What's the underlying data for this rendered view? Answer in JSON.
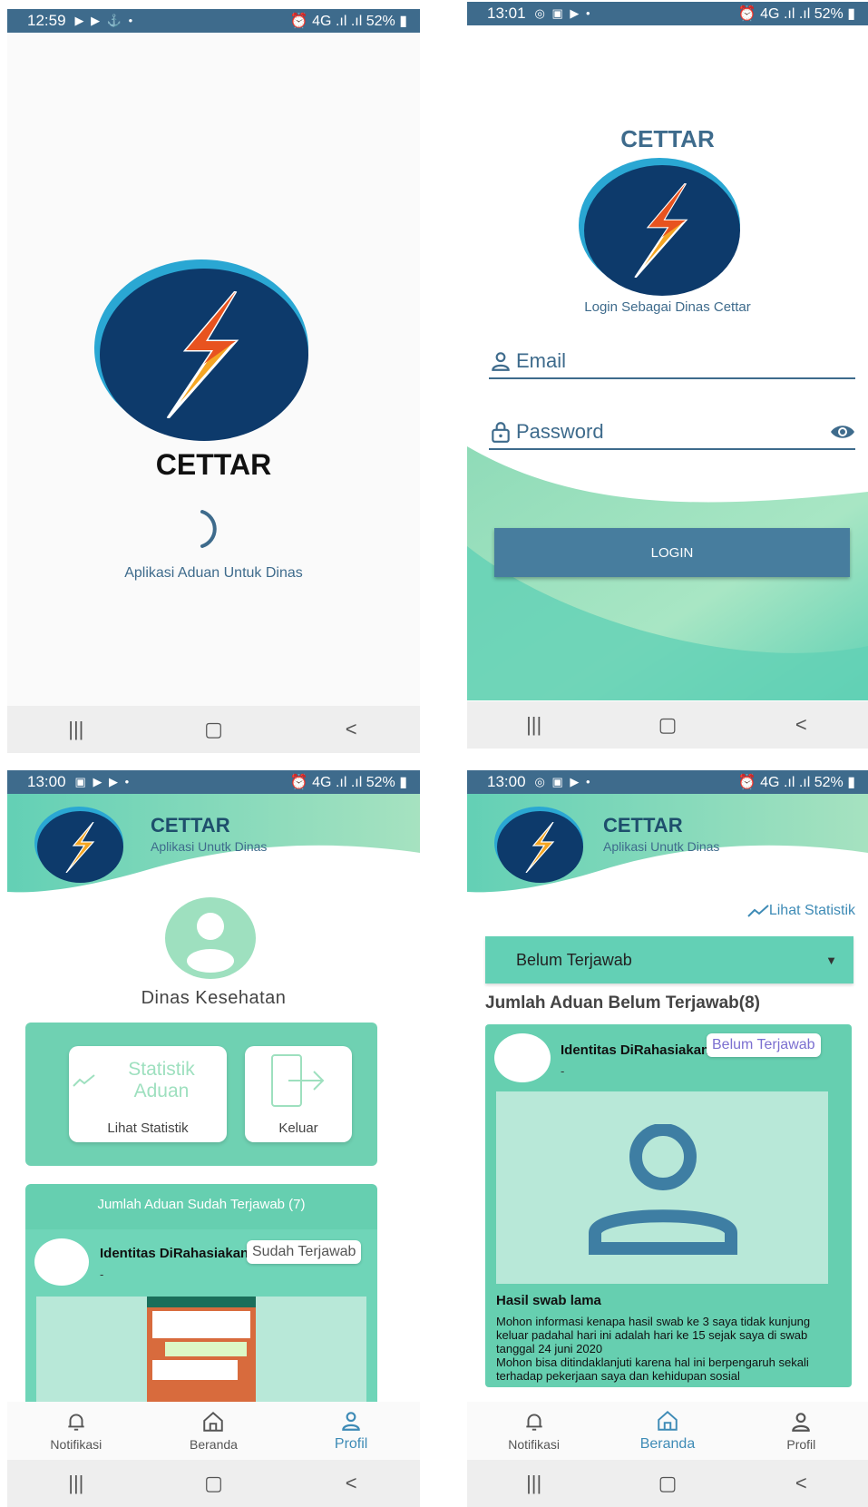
{
  "status": {
    "s1_time": "12:59",
    "s2_time": "13:01",
    "s3_time": "13:00",
    "s4_time": "13:00",
    "right": "52%"
  },
  "splash": {
    "app_name": "CETTAR",
    "tagline": "Aplikasi Aduan Untuk Dinas"
  },
  "login": {
    "app_name": "CETTAR",
    "subtitle": "Login Sebagai Dinas Cettar",
    "email_placeholder": "Email",
    "password_placeholder": "Password",
    "login_label": "LOGIN"
  },
  "header": {
    "title": "CETTAR",
    "subtitle": "Aplikasi Unutk Dinas"
  },
  "profile": {
    "name": "Dinas Kesehatan",
    "stat_card_title": "Statistik Aduan",
    "stat_card_label": "Lihat Statistik",
    "logout_label": "Keluar",
    "answered_heading": "Jumlah Aduan Sudah Terjawab (7)",
    "complaint_identity": "Identitas DiRahasiakan",
    "complaint_dash": "-",
    "complaint_badge": "Sudah Terjawab"
  },
  "home": {
    "stats_link": "Lihat Statistik",
    "filter_selected": "Belum Terjawab",
    "count_heading": "Jumlah Aduan Belum Terjawab(8)",
    "complaint_identity": "Identitas DiRahasiakan",
    "complaint_dash": "-",
    "complaint_badge": "Belum Terjawab",
    "complaint_title": "Hasil swab lama",
    "complaint_body_1": "Mohon informasi kenapa hasil swab ke 3 saya tidak kunjung keluar padahal hari ini adalah hari ke 15 sejak saya di swab tanggal 24 juni 2020",
    "complaint_body_2": "Mohon bisa ditindaklanjuti karena hal ini berpengaruh sekali terhadap pekerjaan saya dan kehidupan sosial"
  },
  "tabs": {
    "notif": "Notifikasi",
    "home": "Beranda",
    "profile": "Profil"
  },
  "colors": {
    "primary": "#3e6b8c",
    "green": "#66cfb0",
    "light_green": "#b8e8d8",
    "accent_purple": "#7b6fd0"
  }
}
